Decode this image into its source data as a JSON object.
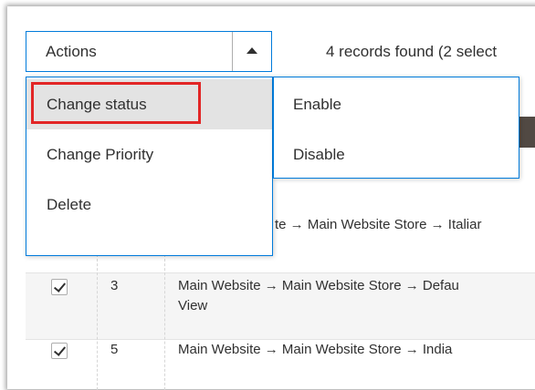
{
  "actions": {
    "label": "Actions",
    "toggle_icon": "triangle-up-icon"
  },
  "records_text": "4 records found (2 select",
  "menu": {
    "items": [
      {
        "label": "Change status"
      },
      {
        "label": "Change Priority"
      },
      {
        "label": "Delete"
      }
    ]
  },
  "submenu": {
    "items": [
      {
        "label": "Enable"
      },
      {
        "label": "Disable"
      }
    ]
  },
  "grid": {
    "rows": [
      {
        "id": "",
        "path": "te → Main Website Store → Italiar",
        "path_cont": ""
      },
      {
        "id": "3",
        "path": "Main Website → Main Website Store → Defau",
        "path_cont": "View"
      },
      {
        "id": "5",
        "path": "Main Website → Main Website Store → India",
        "path_cont": ""
      }
    ]
  },
  "colors": {
    "accent": "#007bdb",
    "highlight": "#e22626",
    "header_dark": "#514943"
  }
}
